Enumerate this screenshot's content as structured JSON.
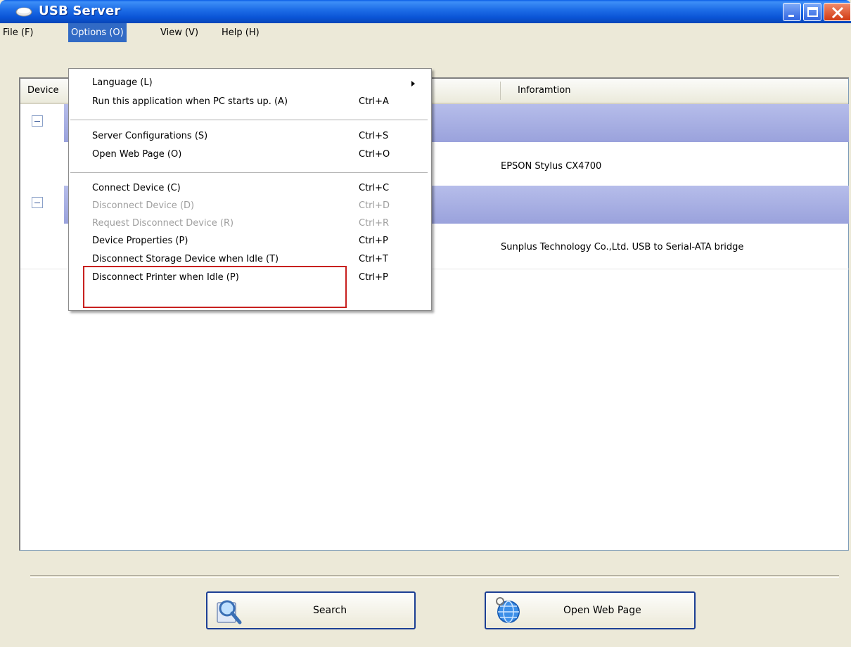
{
  "window": {
    "title": "USB Server"
  },
  "menubar": {
    "items": [
      "File (F)",
      "Options (O)",
      "View (V)",
      "Help (H)"
    ],
    "active": "Options (O)"
  },
  "table": {
    "columns": [
      "Device",
      "Inforamtion"
    ],
    "rows": [
      {
        "info": ""
      },
      {
        "info": "EPSON Stylus CX4700"
      },
      {
        "info": ""
      },
      {
        "info": "Sunplus Technology Co.,Ltd. USB to Serial-ATA bridge"
      }
    ]
  },
  "options_menu": {
    "items": [
      {
        "label": "Language (L)",
        "shortcut": "",
        "enabled": true,
        "submenu": true
      },
      {
        "label": "Run this application when PC starts up. (A)",
        "shortcut": "Ctrl+A",
        "enabled": true
      },
      {
        "label": "Server Configurations (S)",
        "shortcut": "Ctrl+S",
        "enabled": true
      },
      {
        "label": "Open Web Page (O)",
        "shortcut": "Ctrl+O",
        "enabled": true
      },
      {
        "label": "Connect Device (C)",
        "shortcut": "Ctrl+C",
        "enabled": true
      },
      {
        "label": "Disconnect Device  (D)",
        "shortcut": "Ctrl+D",
        "enabled": false
      },
      {
        "label": "Request Disconnect Device  (R)",
        "shortcut": "Ctrl+R",
        "enabled": false
      },
      {
        "label": "Device Properties  (P)",
        "shortcut": "Ctrl+P",
        "enabled": true
      },
      {
        "label": "Disconnect Storage Device when Idle  (T)",
        "shortcut": "Ctrl+T",
        "enabled": true
      },
      {
        "label": "Disconnect Printer when Idle  (P)",
        "shortcut": "Ctrl+P",
        "enabled": true
      }
    ]
  },
  "buttons": {
    "search": "Search",
    "open_web_page": "Open Web Page"
  },
  "colors": {
    "titlebar": "#0a54d6",
    "menu_highlight": "#316ac5",
    "row_band": "#a8b0e4",
    "annotation_box": "#c8201f"
  }
}
